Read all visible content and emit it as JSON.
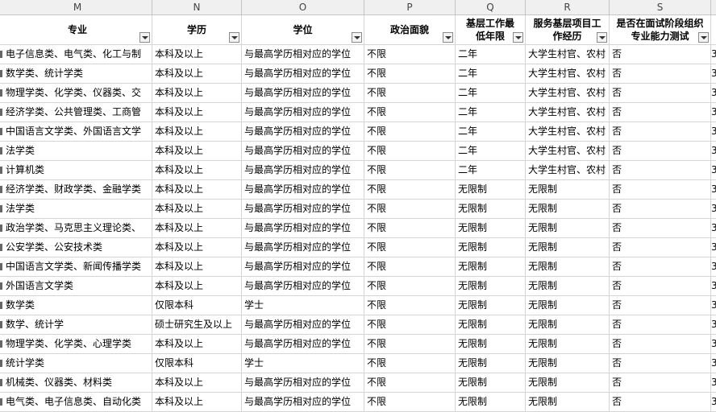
{
  "column_letters": [
    "M",
    "N",
    "O",
    "P",
    "Q",
    "R",
    "S"
  ],
  "headers": [
    {
      "label": "专业",
      "filter": true
    },
    {
      "label": "学历",
      "filter": true
    },
    {
      "label": "学位",
      "filter": true
    },
    {
      "label": "政治面貌",
      "filter": true
    },
    {
      "label": "基层工作最低年限",
      "filter": true
    },
    {
      "label": "服务基层项目工作经历",
      "filter": true
    },
    {
      "label": "是否在面试阶段组织专业能力测试",
      "filter": true
    }
  ],
  "right_edge_value": "3",
  "rows": [
    [
      "电子信息类、电气类、化工与制",
      "本科及以上",
      "与最高学历相对应的学位",
      "不限",
      "二年",
      "大学生村官、农村",
      "否"
    ],
    [
      "数学类、统计学类",
      "本科及以上",
      "与最高学历相对应的学位",
      "不限",
      "二年",
      "大学生村官、农村",
      "否"
    ],
    [
      "物理学类、化学类、仪器类、交",
      "本科及以上",
      "与最高学历相对应的学位",
      "不限",
      "二年",
      "大学生村官、农村",
      "否"
    ],
    [
      "经济学类、公共管理类、工商管",
      "本科及以上",
      "与最高学历相对应的学位",
      "不限",
      "二年",
      "大学生村官、农村",
      "否"
    ],
    [
      "中国语言文学类、外国语言文学",
      "本科及以上",
      "与最高学历相对应的学位",
      "不限",
      "二年",
      "大学生村官、农村",
      "否"
    ],
    [
      "法学类",
      "本科及以上",
      "与最高学历相对应的学位",
      "不限",
      "二年",
      "大学生村官、农村",
      "否"
    ],
    [
      "计算机类",
      "本科及以上",
      "与最高学历相对应的学位",
      "不限",
      "二年",
      "大学生村官、农村",
      "否"
    ],
    [
      "经济学类、财政学类、金融学类",
      "本科及以上",
      "与最高学历相对应的学位",
      "不限",
      "无限制",
      "无限制",
      "否"
    ],
    [
      "法学类",
      "本科及以上",
      "与最高学历相对应的学位",
      "不限",
      "无限制",
      "无限制",
      "否"
    ],
    [
      "政治学类、马克思主义理论类、",
      "本科及以上",
      "与最高学历相对应的学位",
      "不限",
      "无限制",
      "无限制",
      "否"
    ],
    [
      "公安学类、公安技术类",
      "本科及以上",
      "与最高学历相对应的学位",
      "不限",
      "无限制",
      "无限制",
      "否"
    ],
    [
      "中国语言文学类、新闻传播学类",
      "本科及以上",
      "与最高学历相对应的学位",
      "不限",
      "无限制",
      "无限制",
      "否"
    ],
    [
      "外国语言文学类",
      "本科及以上",
      "与最高学历相对应的学位",
      "不限",
      "无限制",
      "无限制",
      "否"
    ],
    [
      "数学类",
      "仅限本科",
      "学士",
      "不限",
      "无限制",
      "无限制",
      "否"
    ],
    [
      "数学、统计学",
      "硕士研究生及以上",
      "与最高学历相对应的学位",
      "不限",
      "无限制",
      "无限制",
      "否"
    ],
    [
      "物理学类、化学类、心理学类",
      "本科及以上",
      "与最高学历相对应的学位",
      "不限",
      "无限制",
      "无限制",
      "否"
    ],
    [
      "统计学类",
      "仅限本科",
      "学士",
      "不限",
      "无限制",
      "无限制",
      "否"
    ],
    [
      "机械类、仪器类、材料类",
      "本科及以上",
      "与最高学历相对应的学位",
      "不限",
      "无限制",
      "无限制",
      "否"
    ],
    [
      "电气类、电子信息类、自动化类",
      "本科及以上",
      "与最高学历相对应的学位",
      "不限",
      "无限制",
      "无限制",
      "否"
    ]
  ]
}
